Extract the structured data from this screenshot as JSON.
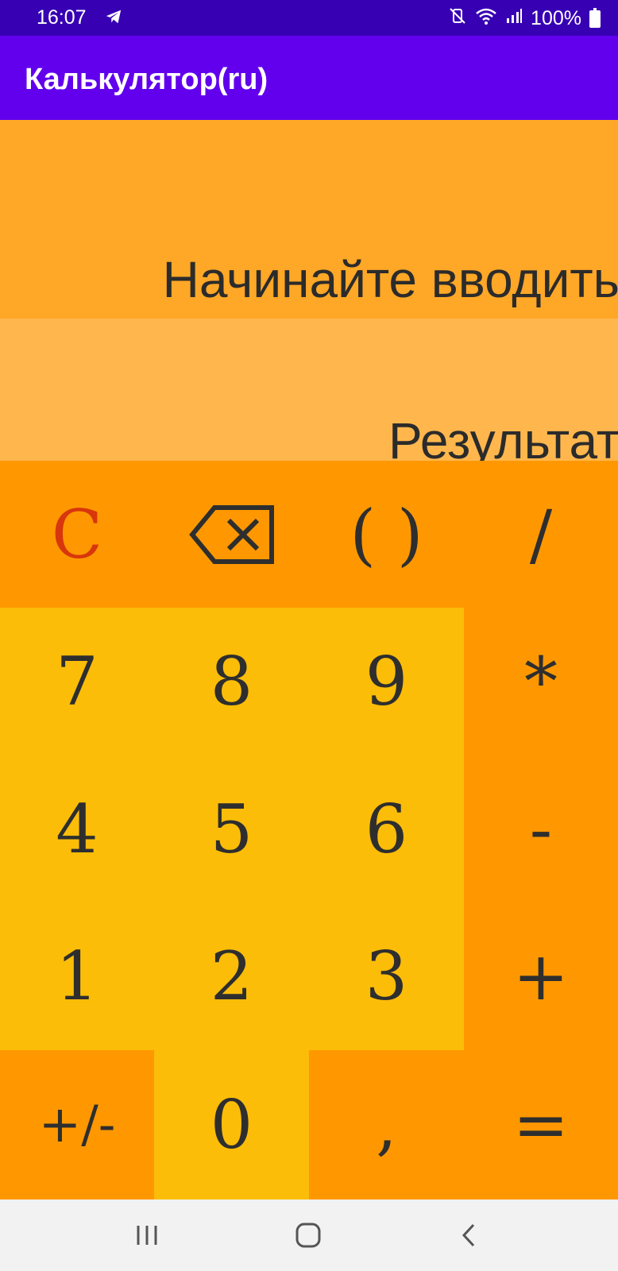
{
  "status_bar": {
    "time": "16:07",
    "battery_percent": "100%",
    "icons": [
      "telegram-icon",
      "mute-vibrate-icon",
      "wifi-icon",
      "signal-icon",
      "battery-icon"
    ]
  },
  "app_bar": {
    "title": "Калькулятор(ru)",
    "color": "#6200ee"
  },
  "display": {
    "input_text": "Начинайте вводить",
    "result_text": "Результат"
  },
  "keypad": {
    "row1": {
      "clear": "C",
      "backspace_icon": "backspace-icon",
      "parentheses": "( )",
      "divide": "/"
    },
    "row2": {
      "k7": "7",
      "k8": "8",
      "k9": "9",
      "multiply": "*"
    },
    "row3": {
      "k4": "4",
      "k5": "5",
      "k6": "6",
      "minus": "-"
    },
    "row4": {
      "k1": "1",
      "k2": "2",
      "k3": "3",
      "plus": "+"
    },
    "row5": {
      "sign": "+/-",
      "k0": "0",
      "comma": ",",
      "equals": "="
    }
  },
  "colors": {
    "input_bg": "#ffa726",
    "result_bg": "#ffb74d",
    "operator_bg": "#ff9800",
    "digit_bg": "#fbbd08",
    "clear_text": "#d8360c"
  },
  "nav_bar": {
    "icons": [
      "recent-apps-icon",
      "home-icon",
      "back-icon"
    ]
  }
}
